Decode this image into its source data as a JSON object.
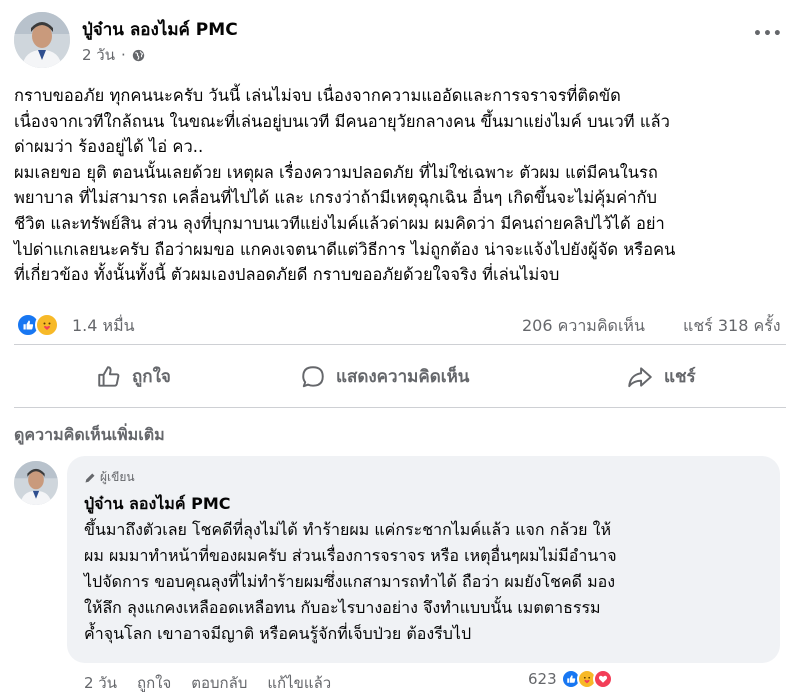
{
  "post": {
    "author": "ปู่จ๋าน ลองไมค์ PMC",
    "time": "2 วัน",
    "separator": "·",
    "paragraphs": [
      "กราบขออภัย ทุกคนนะครับ วันนี้ เล่นไม่จบ เนื่องจากความแออัดและการจราจรที่ติดขัด",
      "เนื่องจากเวทีใกล้ถนน ในขณะที่เล่นอยู่บนเวที มีคนอายุวัยกลางคน ขึ้นมาแย่งไมค์ บนเวที แล้ว",
      "ด่าผมว่า ร้องอยู่ได้ ไอ่ คว..",
      "ผมเลยขอ ยุติ ตอนนั้นเลยด้วย เหตุผล เรื่องความปลอดภัย ที่ไม่ใช่เฉพาะ ตัวผม แต่มีคนในรถ",
      "พยาบาล ที่ไม่สามารถ เคลื่อนที่ไปได้ และ เกรงว่าถ้ามีเหตุฉุกเฉิน อื่นๆ เกิดขึ้นจะไม่คุ้มค่ากับ",
      "ชีวิต และทรัพย์สิน ส่วน ลุงที่บุกมาบนเวทีแย่งไมค์แล้วด่าผม ผมคิดว่า มีคนถ่ายคลิปไว้ได้ อย่า",
      "ไปด่าแกเลยนะครับ ถือว่าผมขอ แกคงเจตนาดีแต่วิธีการ ไม่ถูกต้อง น่าจะแจ้งไปยังผู้จัด หรือคน",
      "ที่เกี่ยวข้อง ทั้งนั้นทั้งนี้ ตัวผมเองปลอดภัยดี กราบขออภัยด้วยใจจริง ที่เล่นไม่จบ"
    ],
    "reactions_count": "1.4 หมื่น",
    "comments_count": "206 ความคิดเห็น",
    "shares_count": "แชร์ 318 ครั้ง",
    "like_label": "ถูกใจ",
    "comment_label": "แสดงความคิดเห็น",
    "share_label": "แชร์",
    "more_comments": "ดูความคิดเห็นเพิ่มเติม",
    "more_icon": "•••"
  },
  "comment": {
    "badge": "ผู้เขียน",
    "author": "ปู่จ๋าน ลองไมค์ PMC",
    "lines": [
      "ขึ้นมาถึงตัวเลย โชคดีที่ลุงไม่ได้ ทำร้ายผม แค่กระชากไมค์แล้ว แจก กล้วย ให้",
      "ผม ผมมาทำหน้าที่ของผมครับ ส่วนเรื่องการจราจร หรือ เหตุอื่นๆผมไม่มีอำนาจ",
      "ไปจัดการ ขอบคุณลุงที่ไม่ทำร้ายผมซึ่งแกสามารถทำได้ ถือว่า ผมยังโชคดี มอง",
      "ให้ลึก ลุงแกคงเหลืออดเหลือทน กับอะไรบางอย่าง จึงทำแบบนั้น เมตตาธรรม",
      "ค้ำจุนโลก เขาอาจมีญาติ หรือคนรู้จักที่เจ็บป่วย ต้องรีบไป"
    ],
    "time": "2 วัน",
    "like": "ถูกใจ",
    "reply": "ตอบกลับ",
    "edited": "แก้ไขแล้ว",
    "reactions_count": "623"
  },
  "colors": {
    "like_blue": "#1877f2",
    "care_yellow": "#f7b928",
    "love_red": "#f33e58",
    "muted": "#65676b",
    "bubble": "#f0f2f5"
  }
}
